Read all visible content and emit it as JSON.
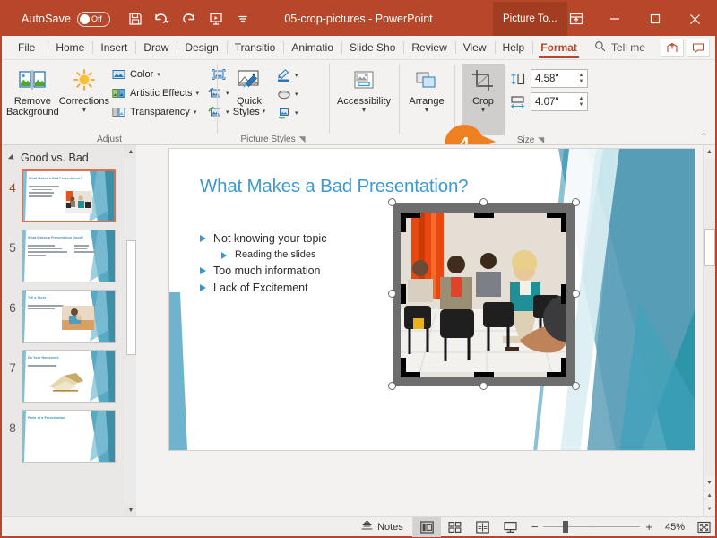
{
  "titlebar": {
    "autosave_label": "AutoSave",
    "autosave_state": "Off",
    "document_title": "05-crop-pictures  -  PowerPoint",
    "context_tab_badge": "Picture To...",
    "qat": [
      {
        "name": "save-icon",
        "label": "Save"
      },
      {
        "name": "undo-icon",
        "label": "Undo"
      },
      {
        "name": "redo-icon",
        "label": "Redo"
      },
      {
        "name": "start-presentation-icon",
        "label": "Start From Beginning"
      },
      {
        "name": "customize-quick-access-toolbar-icon",
        "label": "Customize Quick Access Toolbar"
      }
    ],
    "window_buttons": {
      "ribbon_display_options": "Ribbon Display Options",
      "minimize": "Minimize",
      "maximize": "Maximize",
      "close": "Close"
    }
  },
  "tabs": [
    {
      "label": "File",
      "active": false
    },
    {
      "label": "Home",
      "active": false
    },
    {
      "label": "Insert",
      "active": false
    },
    {
      "label": "Draw",
      "active": false
    },
    {
      "label": "Design",
      "active": false
    },
    {
      "label": "Transitio",
      "active": false
    },
    {
      "label": "Animatio",
      "active": false
    },
    {
      "label": "Slide Sho",
      "active": false
    },
    {
      "label": "Review",
      "active": false
    },
    {
      "label": "View",
      "active": false
    },
    {
      "label": "Help",
      "active": false
    },
    {
      "label": "Format",
      "active": true
    }
  ],
  "tellme": {
    "label": "Tell me",
    "icon": "search-icon"
  },
  "tabstrip_right": [
    {
      "name": "share-button",
      "label": "Share"
    },
    {
      "name": "comments-button",
      "label": "Comments"
    }
  ],
  "ribbon": {
    "groups": [
      {
        "name": "adjust",
        "label": "Adjust",
        "big_buttons": [
          {
            "label": "Remove\nBackground",
            "line1": "Remove",
            "line2": "Background",
            "icon": "remove-background-icon"
          },
          {
            "label": "Corrections",
            "line1": "Corrections",
            "line2": "",
            "icon": "corrections-icon",
            "has_caret": true
          }
        ],
        "small_buttons": [
          {
            "label": "Color",
            "icon": "color-icon",
            "has_caret": true
          },
          {
            "label": "Artistic Effects",
            "icon": "artistic-effects-icon",
            "has_caret": true
          },
          {
            "label": "Transparency",
            "icon": "transparency-icon",
            "has_caret": true
          }
        ],
        "icon_buttons": [
          {
            "label": "Compress Pictures",
            "icon": "compress-pictures-icon",
            "has_caret": false
          },
          {
            "label": "Change Picture",
            "icon": "change-picture-icon",
            "has_caret": true
          },
          {
            "label": "Reset Picture",
            "icon": "reset-picture-icon",
            "has_caret": true
          }
        ]
      },
      {
        "name": "picture-styles",
        "label": "Picture Styles",
        "dialog_launcher": true,
        "big_buttons": [
          {
            "line1": "Quick",
            "line2": "Styles",
            "icon": "quick-styles-icon",
            "has_caret": true
          }
        ],
        "icon_buttons": [
          {
            "label": "Picture Border",
            "icon": "picture-border-icon",
            "has_caret": true
          },
          {
            "label": "Picture Effects",
            "icon": "picture-effects-icon",
            "has_caret": true
          },
          {
            "label": "Picture Layout",
            "icon": "picture-layout-icon",
            "has_caret": true
          }
        ]
      },
      {
        "name": "accessibility",
        "label": "",
        "big_buttons": [
          {
            "line1": "Accessibility",
            "line2": "",
            "icon": "accessibility-icon",
            "has_caret": true
          }
        ]
      },
      {
        "name": "arrange",
        "label": "",
        "big_buttons": [
          {
            "line1": "Arrange",
            "line2": "",
            "icon": "arrange-icon",
            "has_caret": true
          }
        ]
      },
      {
        "name": "size",
        "label": "Size",
        "dialog_launcher": true,
        "big_buttons": [
          {
            "line1": "Crop",
            "line2": "",
            "icon": "crop-icon",
            "has_caret": true,
            "selected": true
          }
        ],
        "fields": [
          {
            "name": "shape-height-field",
            "icon": "shape-height-icon",
            "value": "4.58\""
          },
          {
            "name": "shape-width-field",
            "icon": "shape-width-icon",
            "value": "4.07\""
          }
        ]
      }
    ],
    "collapse_label": "Collapse the Ribbon"
  },
  "callout": {
    "number": "4"
  },
  "slidepanel": {
    "section_name": "Good vs. Bad",
    "slides": [
      {
        "number": "4",
        "current": true,
        "title": "What Makes a Bad Presentation?",
        "bullet_widths": [
          34,
          22,
          28,
          26
        ],
        "has_image": true
      },
      {
        "number": "5",
        "current": false,
        "title": "What Makes a Presentation Good?",
        "bullet_widths": [
          30,
          38,
          44,
          20
        ],
        "has_image": false
      },
      {
        "number": "6",
        "current": false,
        "title": "Tell a Story",
        "bullet_widths": [
          40,
          30
        ],
        "has_image": true
      },
      {
        "number": "7",
        "current": false,
        "title": "Do Your Homework",
        "bullet_widths": [
          32
        ],
        "has_image": true
      },
      {
        "number": "8",
        "current": false,
        "title": "Parts of a Presentation",
        "bullet_widths": [],
        "has_image": false
      }
    ]
  },
  "slide": {
    "title": "What Makes a Bad Presentation?",
    "bullets": [
      {
        "text": "Not knowing your topic",
        "level": 1
      },
      {
        "text": "Reading the slides",
        "level": 2
      },
      {
        "text": "Too much information",
        "level": 1
      },
      {
        "text": "Lack of Excitement",
        "level": 1
      }
    ],
    "picture": {
      "name": "conference-audience-picture",
      "crop_mode": true,
      "alt": "Bored audience sitting in chairs in a conference room"
    }
  },
  "statusbar": {
    "notes_label": "Notes",
    "views": [
      {
        "name": "normal-view-button",
        "label": "Normal",
        "active": true
      },
      {
        "name": "slide-sorter-view-button",
        "label": "Slide Sorter",
        "active": false
      },
      {
        "name": "reading-view-button",
        "label": "Reading View",
        "active": false
      },
      {
        "name": "slide-show-button",
        "label": "Slide Show",
        "active": false
      }
    ],
    "zoom_out": "−",
    "zoom_in": "+",
    "zoom_percent": "45%",
    "fit_label": "Fit slide to current window"
  },
  "colors": {
    "brand": "#b7472a",
    "context_badge": "#a33d22",
    "callout": "#ef8022",
    "title_blue": "#3b9ad1",
    "bullet_blue": "#2e9bd6",
    "selected_thumb_border": "#e86c4a"
  }
}
